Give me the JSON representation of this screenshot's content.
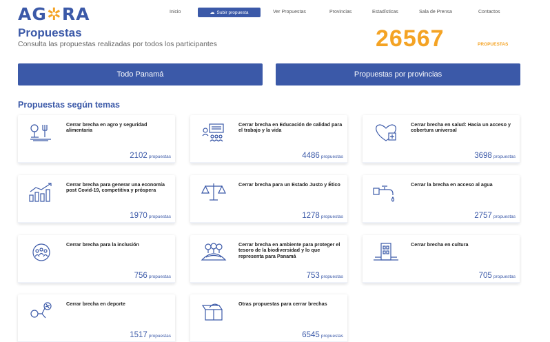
{
  "header": {
    "logo": {
      "left": "AG",
      "mid": "✲",
      "right": "RA"
    },
    "nav": [
      {
        "label": "Inicio"
      },
      {
        "label": "Subir propuesta"
      },
      {
        "label": "Ver Propuestas"
      },
      {
        "label": "Provincias"
      },
      {
        "label": "Estadísticas"
      },
      {
        "label": "Sala de Prensa"
      },
      {
        "label": "Contactos"
      }
    ]
  },
  "main": {
    "title": "Propuestas",
    "subtitle": "Consulta las propuestas realizadas por todos los participantes",
    "total_count": "26567",
    "total_label": "PROPUESTAS",
    "buttons": {
      "all": "Todo Panamá",
      "provinces": "Propuestas por provincias"
    },
    "section_title": "Propuestas según temas",
    "count_unit": "propuestas",
    "topics": [
      {
        "title": "Cerrar brecha en agro y seguridad alimentaria",
        "count": "2102",
        "icon": "agro-icon"
      },
      {
        "title": "Cerrar brecha en Educación de calidad para el trabajo y la vida",
        "count": "4486",
        "icon": "education-icon"
      },
      {
        "title": "Cerrar brecha en salud: Hacia un acceso y cobertura universal",
        "count": "3698",
        "icon": "health-icon"
      },
      {
        "title": "Cerrar brecha para generar una economía post Covid-19, competitiva y próspera",
        "count": "1970",
        "icon": "economy-icon"
      },
      {
        "title": "Cerrar brecha para un Estado Justo y Ético",
        "count": "1278",
        "icon": "justice-icon"
      },
      {
        "title": "Cerrar la brecha en acceso al agua",
        "count": "2757",
        "icon": "water-icon"
      },
      {
        "title": "Cerrar brecha para la inclusión",
        "count": "756",
        "icon": "inclusion-icon"
      },
      {
        "title": "Cerrar brecha en ambiente para proteger el tesoro de la biodiversidad y lo que representa para Panamá",
        "count": "753",
        "icon": "environment-icon"
      },
      {
        "title": "Cerrar brecha en cultura",
        "count": "705",
        "icon": "culture-icon"
      },
      {
        "title": "Cerrar brecha en deporte",
        "count": "1517",
        "icon": "sport-icon"
      },
      {
        "title": "Otras propuestas para cerrar brechas",
        "count": "6545",
        "icon": "box-icon"
      }
    ]
  },
  "colors": {
    "primary": "#3b59a8",
    "accent": "#f4a324",
    "icon_stroke": "#3b59a8"
  }
}
